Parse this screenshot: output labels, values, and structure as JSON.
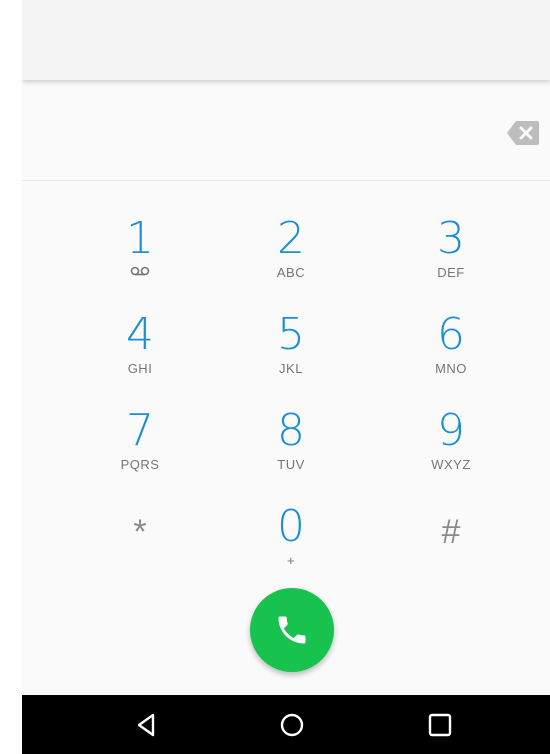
{
  "dialer": {
    "number_display": "",
    "keys": [
      {
        "digit": "1",
        "letters": "",
        "icon": "voicemail-icon"
      },
      {
        "digit": "2",
        "letters": "ABC"
      },
      {
        "digit": "3",
        "letters": "DEF"
      },
      {
        "digit": "4",
        "letters": "GHI"
      },
      {
        "digit": "5",
        "letters": "JKL"
      },
      {
        "digit": "6",
        "letters": "MNO"
      },
      {
        "digit": "7",
        "letters": "PQRS"
      },
      {
        "digit": "8",
        "letters": "TUV"
      },
      {
        "digit": "9",
        "letters": "WXYZ"
      },
      {
        "digit": "*",
        "letters": ""
      },
      {
        "digit": "0",
        "letters": "+"
      },
      {
        "digit": "#",
        "letters": ""
      }
    ],
    "backspace_icon": "backspace-icon",
    "call_icon": "phone-icon"
  },
  "navigation": {
    "back_icon": "back-triangle-icon",
    "home_icon": "home-circle-icon",
    "recents_icon": "recents-square-icon"
  },
  "colors": {
    "digit": "#1a8fd2",
    "call_button": "#17c24f",
    "nav_bar": "#000000"
  }
}
